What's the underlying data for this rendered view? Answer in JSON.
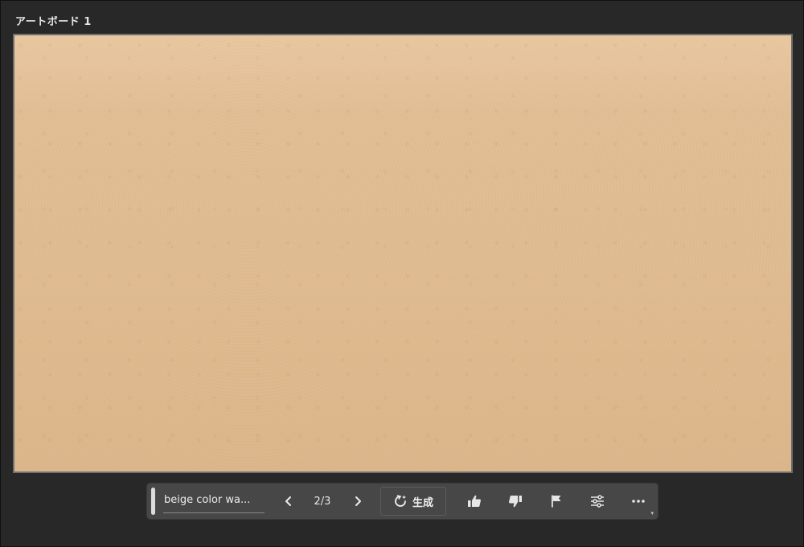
{
  "artboard": {
    "label": "アートボード 1"
  },
  "taskbar": {
    "prompt_value": "beige color wa...",
    "counter": "2/3",
    "generate_label": "生成",
    "icons": {
      "prev": "chevron-left-icon",
      "next": "chevron-right-icon",
      "generate": "refresh-sparkle-icon",
      "like": "thumbs-up-icon",
      "dislike": "thumbs-down-icon",
      "report": "flag-icon",
      "settings": "sliders-icon",
      "more": "more-horizontal-icon"
    }
  },
  "colors": {
    "canvas_bg": "#282828",
    "taskbar_bg": "#474747",
    "artboard_fill": "#e0bc92"
  }
}
